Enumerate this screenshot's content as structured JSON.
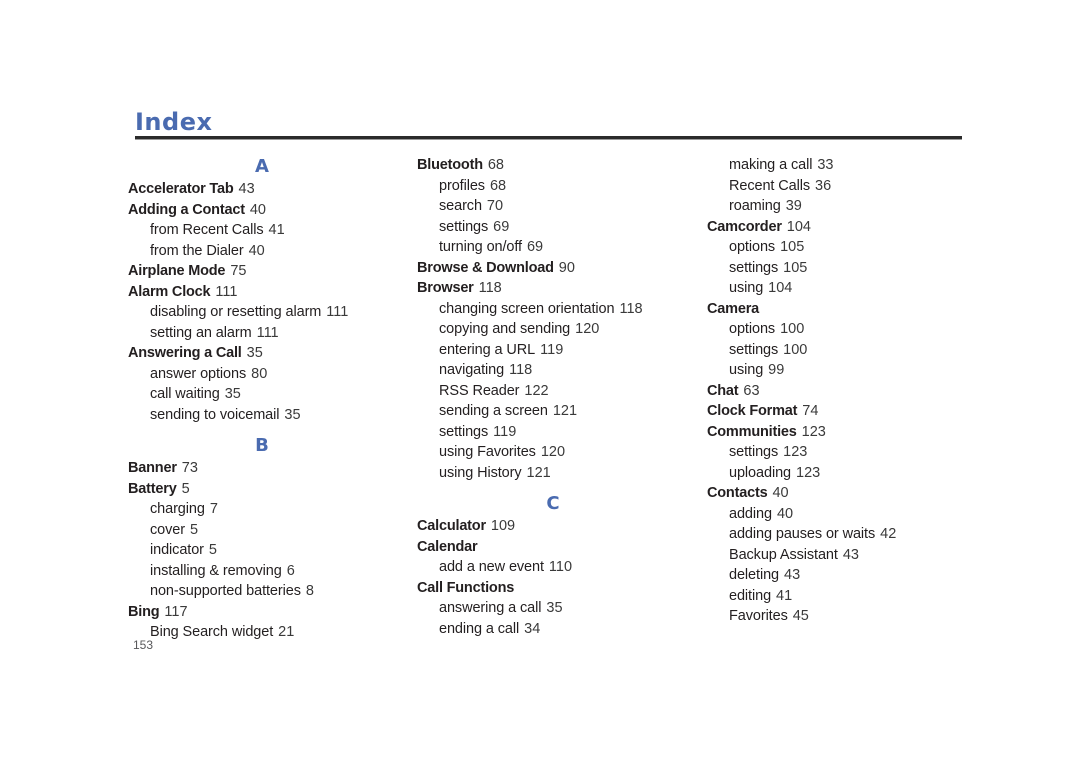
{
  "document": {
    "title": "Index",
    "folio": "153",
    "accent_color": "#4a6bb0",
    "text_color": "#231f20"
  },
  "columns": [
    {
      "id": "column-1",
      "blocks": [
        {
          "type": "letter",
          "text": "A"
        },
        {
          "type": "entry",
          "level": "main",
          "label": "Accelerator Tab",
          "page": "43"
        },
        {
          "type": "entry",
          "level": "main",
          "label": "Adding a Contact",
          "page": "40"
        },
        {
          "type": "entry",
          "level": "sub",
          "label": "from Recent Calls",
          "page": "41"
        },
        {
          "type": "entry",
          "level": "sub",
          "label": "from the Dialer",
          "page": "40"
        },
        {
          "type": "entry",
          "level": "main",
          "label": "Airplane Mode",
          "page": "75"
        },
        {
          "type": "entry",
          "level": "main",
          "label": "Alarm Clock",
          "page": "111"
        },
        {
          "type": "entry",
          "level": "sub",
          "label": "disabling or resetting alarm",
          "page": "111"
        },
        {
          "type": "entry",
          "level": "sub",
          "label": "setting an alarm",
          "page": "111"
        },
        {
          "type": "entry",
          "level": "main",
          "label": "Answering a Call",
          "page": "35"
        },
        {
          "type": "entry",
          "level": "sub",
          "label": "answer options",
          "page": "80"
        },
        {
          "type": "entry",
          "level": "sub",
          "label": "call waiting",
          "page": "35"
        },
        {
          "type": "entry",
          "level": "sub",
          "label": "sending to voicemail",
          "page": "35"
        },
        {
          "type": "letter",
          "text": "B"
        },
        {
          "type": "entry",
          "level": "main",
          "label": "Banner",
          "page": "73"
        },
        {
          "type": "entry",
          "level": "main",
          "label": "Battery",
          "page": "5"
        },
        {
          "type": "entry",
          "level": "sub",
          "label": "charging",
          "page": "7"
        },
        {
          "type": "entry",
          "level": "sub",
          "label": "cover",
          "page": "5"
        },
        {
          "type": "entry",
          "level": "sub",
          "label": "indicator",
          "page": "5"
        },
        {
          "type": "entry",
          "level": "sub",
          "label": "installing & removing",
          "page": "6"
        },
        {
          "type": "entry",
          "level": "sub",
          "label": "non-supported batteries",
          "page": "8"
        },
        {
          "type": "entry",
          "level": "main",
          "label": "Bing",
          "page": "117"
        },
        {
          "type": "entry",
          "level": "sub",
          "label": "Bing Search widget",
          "page": "21"
        }
      ]
    },
    {
      "id": "column-2",
      "blocks": [
        {
          "type": "entry",
          "level": "main",
          "label": "Bluetooth",
          "page": "68"
        },
        {
          "type": "entry",
          "level": "sub",
          "label": "profiles",
          "page": "68"
        },
        {
          "type": "entry",
          "level": "sub",
          "label": "search",
          "page": "70"
        },
        {
          "type": "entry",
          "level": "sub",
          "label": "settings",
          "page": "69"
        },
        {
          "type": "entry",
          "level": "sub",
          "label": "turning on/off",
          "page": "69"
        },
        {
          "type": "entry",
          "level": "main",
          "label": "Browse & Download",
          "page": "90"
        },
        {
          "type": "entry",
          "level": "main",
          "label": "Browser",
          "page": "118"
        },
        {
          "type": "entry",
          "level": "sub",
          "label": "changing screen orientation",
          "page": "118"
        },
        {
          "type": "entry",
          "level": "sub",
          "label": "copying and sending",
          "page": "120"
        },
        {
          "type": "entry",
          "level": "sub",
          "label": "entering a URL",
          "page": "119"
        },
        {
          "type": "entry",
          "level": "sub",
          "label": "navigating",
          "page": "118"
        },
        {
          "type": "entry",
          "level": "sub",
          "label": "RSS Reader",
          "page": "122"
        },
        {
          "type": "entry",
          "level": "sub",
          "label": "sending a screen",
          "page": "121"
        },
        {
          "type": "entry",
          "level": "sub",
          "label": "settings",
          "page": "119"
        },
        {
          "type": "entry",
          "level": "sub",
          "label": "using Favorites",
          "page": "120"
        },
        {
          "type": "entry",
          "level": "sub",
          "label": "using History",
          "page": "121"
        },
        {
          "type": "letter",
          "text": "C"
        },
        {
          "type": "entry",
          "level": "main",
          "label": "Calculator",
          "page": "109"
        },
        {
          "type": "entry",
          "level": "main",
          "label": "Calendar",
          "page": ""
        },
        {
          "type": "entry",
          "level": "sub",
          "label": "add a new event",
          "page": "110"
        },
        {
          "type": "entry",
          "level": "main",
          "label": "Call Functions",
          "page": ""
        },
        {
          "type": "entry",
          "level": "sub",
          "label": "answering a call",
          "page": "35"
        },
        {
          "type": "entry",
          "level": "sub",
          "label": "ending a call",
          "page": "34"
        }
      ]
    },
    {
      "id": "column-3",
      "blocks": [
        {
          "type": "entry",
          "level": "sub",
          "label": "making a call",
          "page": "33"
        },
        {
          "type": "entry",
          "level": "sub",
          "label": "Recent Calls",
          "page": "36"
        },
        {
          "type": "entry",
          "level": "sub",
          "label": "roaming",
          "page": "39"
        },
        {
          "type": "entry",
          "level": "main",
          "label": "Camcorder",
          "page": "104"
        },
        {
          "type": "entry",
          "level": "sub",
          "label": "options",
          "page": "105"
        },
        {
          "type": "entry",
          "level": "sub",
          "label": "settings",
          "page": "105"
        },
        {
          "type": "entry",
          "level": "sub",
          "label": "using",
          "page": "104"
        },
        {
          "type": "entry",
          "level": "main",
          "label": "Camera",
          "page": ""
        },
        {
          "type": "entry",
          "level": "sub",
          "label": "options",
          "page": "100"
        },
        {
          "type": "entry",
          "level": "sub",
          "label": "settings",
          "page": "100"
        },
        {
          "type": "entry",
          "level": "sub",
          "label": "using",
          "page": "99"
        },
        {
          "type": "entry",
          "level": "main",
          "label": "Chat",
          "page": "63"
        },
        {
          "type": "entry",
          "level": "main",
          "label": "Clock Format",
          "page": "74"
        },
        {
          "type": "entry",
          "level": "main",
          "label": "Communities",
          "page": "123"
        },
        {
          "type": "entry",
          "level": "sub",
          "label": "settings",
          "page": "123"
        },
        {
          "type": "entry",
          "level": "sub",
          "label": "uploading",
          "page": "123"
        },
        {
          "type": "entry",
          "level": "main",
          "label": "Contacts",
          "page": "40"
        },
        {
          "type": "entry",
          "level": "sub",
          "label": "adding",
          "page": "40"
        },
        {
          "type": "entry",
          "level": "sub",
          "label": "adding pauses or waits",
          "page": "42"
        },
        {
          "type": "entry",
          "level": "sub",
          "label": "Backup Assistant",
          "page": "43"
        },
        {
          "type": "entry",
          "level": "sub",
          "label": "deleting",
          "page": "43"
        },
        {
          "type": "entry",
          "level": "sub",
          "label": "editing",
          "page": "41"
        },
        {
          "type": "entry",
          "level": "sub",
          "label": "Favorites",
          "page": "45"
        }
      ]
    }
  ]
}
